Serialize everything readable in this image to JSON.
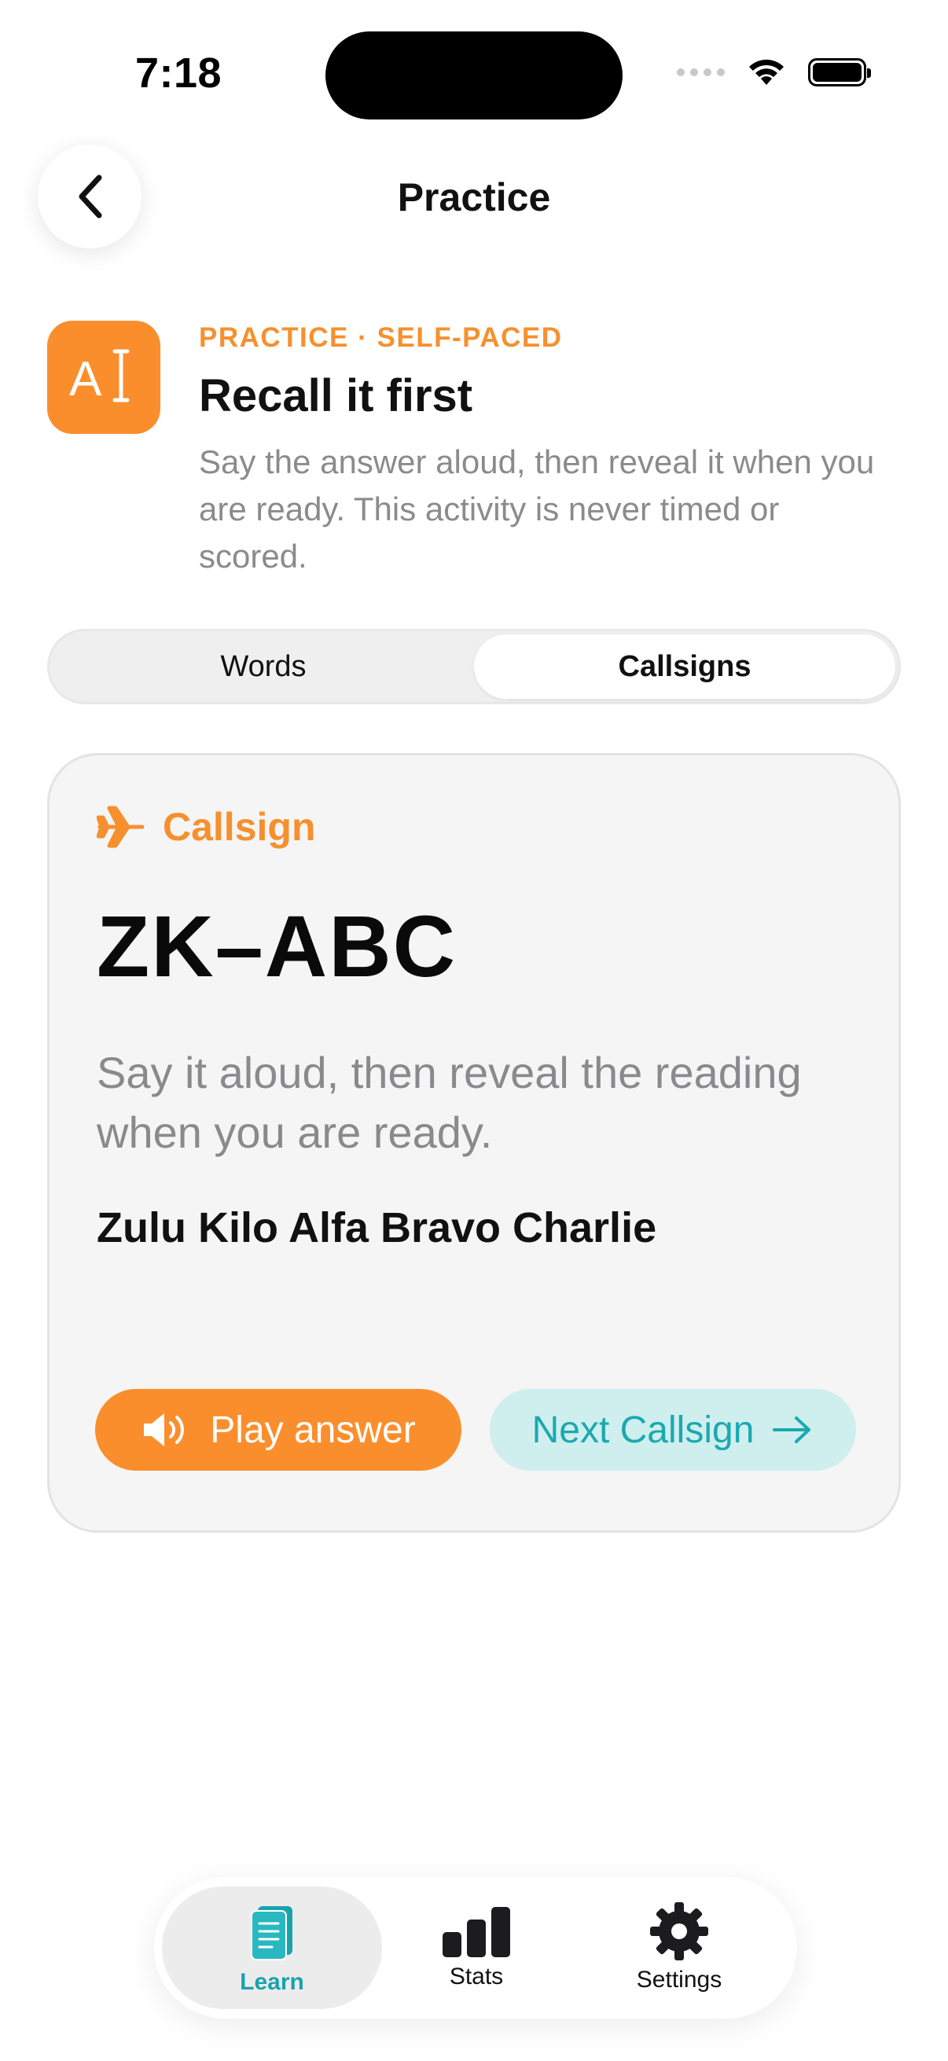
{
  "status_bar": {
    "time": "7:18"
  },
  "nav": {
    "title": "Practice"
  },
  "header": {
    "eyebrow": "PRACTICE · SELF-PACED",
    "title": "Recall it first",
    "description": "Say the answer aloud, then reveal it when you are ready. This activity is never timed or scored.",
    "icon_text": "A"
  },
  "segments": [
    {
      "label": "Words",
      "selected": false
    },
    {
      "label": "Callsigns",
      "selected": true
    }
  ],
  "card": {
    "label": "Callsign",
    "callsign": "ZK–ABC",
    "hint": "Say it aloud, then reveal the reading when you are ready.",
    "reading": "Zulu Kilo Alfa Bravo Charlie",
    "play_label": "Play answer",
    "next_label": "Next Callsign"
  },
  "tabs": [
    {
      "label": "Learn",
      "icon": "book-icon",
      "active": true
    },
    {
      "label": "Stats",
      "icon": "bar-chart-icon",
      "active": false
    },
    {
      "label": "Settings",
      "icon": "gear-icon",
      "active": false
    }
  ],
  "colors": {
    "accent_orange": "#fb8e2c",
    "accent_teal": "#1aa9b0",
    "teal_bg": "#cfeeee",
    "card_bg": "#f4f5f4"
  }
}
